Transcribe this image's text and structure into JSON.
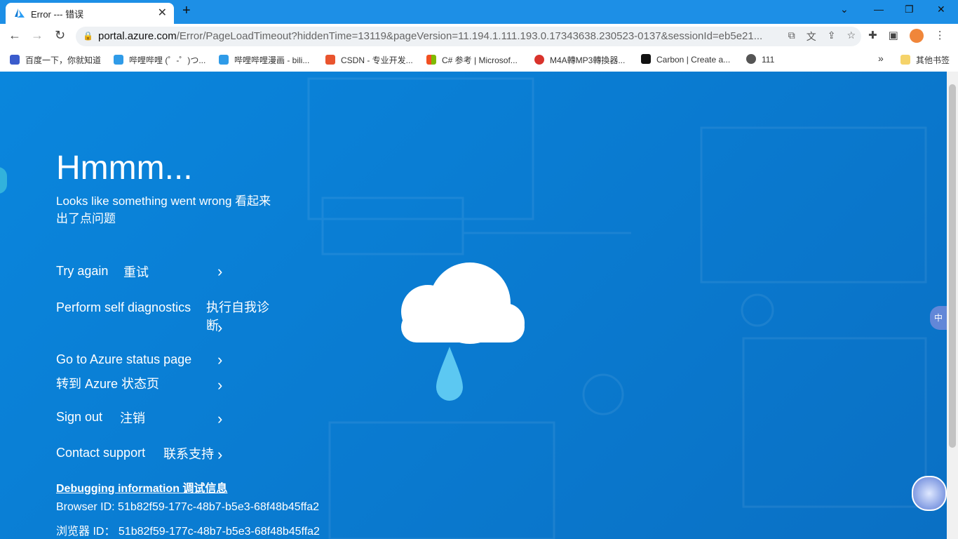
{
  "browser": {
    "tab": {
      "title": "Error --- 错误",
      "close_glyph": "✕"
    },
    "new_tab_glyph": "+",
    "window_controls": {
      "minimize": "—",
      "restore": "❐",
      "close": "✕"
    },
    "nav": {
      "back": "←",
      "forward": "→",
      "reload": "↻"
    },
    "url": {
      "host": "portal.azure.com",
      "path": "/Error/PageLoadTimeout?hiddenTime=13119&pageVersion=11.194.1.111.193.0.17343638.230523-0137&sessionId=eb5e21..."
    },
    "omni_icons": [
      "open-in-app-icon",
      "translate-icon",
      "share-icon",
      "bookmark-star-icon"
    ],
    "toolbar_icons": [
      "extensions-icon",
      "side-panel-icon",
      "profile-avatar-icon",
      "menu-icon"
    ],
    "bookmarks": [
      {
        "label": "百度一下，你就知道",
        "color": "#3b5ccc"
      },
      {
        "label": "哔哩哔哩 (゜-゜)つ...",
        "color": "#2f9be8"
      },
      {
        "label": "哔哩哔哩漫画 - bili...",
        "color": "#2f9be8"
      },
      {
        "label": "CSDN - 专业开发...",
        "color": "#e9542e"
      },
      {
        "label": "C# 参考 | Microsof...",
        "color": "#7fba00"
      },
      {
        "label": "M4A轉MP3轉換器...",
        "color": "#d9332c"
      },
      {
        "label": "Carbon | Create a...",
        "color": "#111111"
      },
      {
        "label": "111",
        "color": "#555555"
      }
    ],
    "bookmarks_more": "»",
    "other_bookmarks": "其他书签"
  },
  "page": {
    "title": "Hmmm...",
    "subtitle": "Looks like something went wrong 看起来出了点问题",
    "menu": [
      {
        "en": "Try again",
        "cn": "重试"
      },
      {
        "en": "Perform self diagnostics",
        "cn": "执行自我诊断"
      },
      {
        "en": "Go to Azure status page",
        "cn": "转到 Azure 状态页"
      },
      {
        "en": "Sign out",
        "cn": "注销"
      },
      {
        "en": "Contact support",
        "cn": "联系支持"
      }
    ],
    "chevron": "›",
    "debug_link": "Debugging information 调试信息",
    "browser_id_en": "Browser ID: 51b82f59-177c-48b7-b5e3-68f48b45ffa2",
    "browser_id_cn": "浏览器 ID：  51b82f59-177c-48b7-b5e3-68f48b45ffa2",
    "side_zh": "中"
  },
  "colors": {
    "page_bg": "#0a78c8",
    "accent": "#1d8fe6",
    "cloud": "#ffffff",
    "drop": "#5cc8f2"
  }
}
